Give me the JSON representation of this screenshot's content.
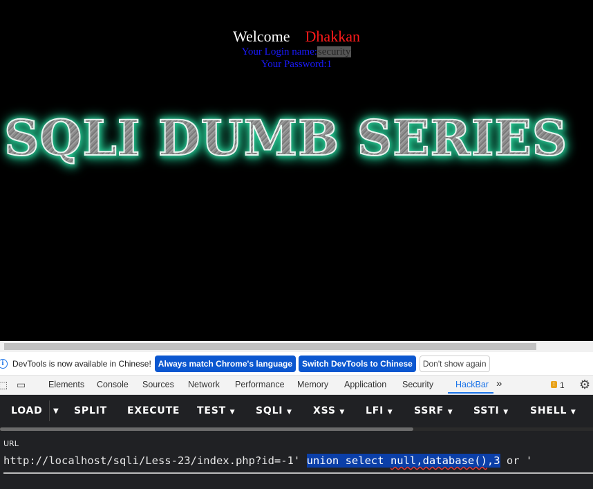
{
  "page": {
    "welcome": "Welcome",
    "username": "Dhakkan",
    "login_label": "Your Login name:",
    "login_value": "security",
    "password_label": "Your Password:",
    "password_value": "1",
    "banner": "SQLI DUMB SERIES"
  },
  "devtools": {
    "infobar": {
      "message": "DevTools is now available in Chinese!",
      "btn_match": "Always match Chrome's language",
      "btn_switch": "Switch DevTools to Chinese",
      "btn_dismiss": "Don't show again"
    },
    "tabs": [
      "Elements",
      "Console",
      "Sources",
      "Network",
      "Performance",
      "Memory",
      "Application",
      "Security",
      "HackBar"
    ],
    "active_tab": "HackBar",
    "more_tabs": "»",
    "issues_count": "1",
    "icons": [
      "inspect-icon",
      "device-toolbar-icon",
      "chevron-right-double-icon",
      "issues-icon",
      "gear-icon",
      "info-icon"
    ]
  },
  "hackbar": {
    "menu": [
      "LOAD",
      "SPLIT",
      "EXECUTE",
      "TEST",
      "SQLI",
      "XSS",
      "LFI",
      "SSRF",
      "SSTI",
      "SHELL"
    ],
    "url_label": "URL",
    "url_prefix": "http://localhost/sqli/Less-23/index.php?id=-1' ",
    "url_selected_a": "union select ",
    "url_selected_b": "null,database()",
    "url_selected_c": ",3",
    "url_suffix": " or '"
  },
  "colors": {
    "welcome": "#ffffff",
    "username": "#ff1a1a",
    "login_text": "#1a1aff",
    "banner_glow": "#2fd6a0",
    "accent": "#1a73e8",
    "hackbar_bg": "#202124",
    "selection": "#0b3fa8"
  }
}
